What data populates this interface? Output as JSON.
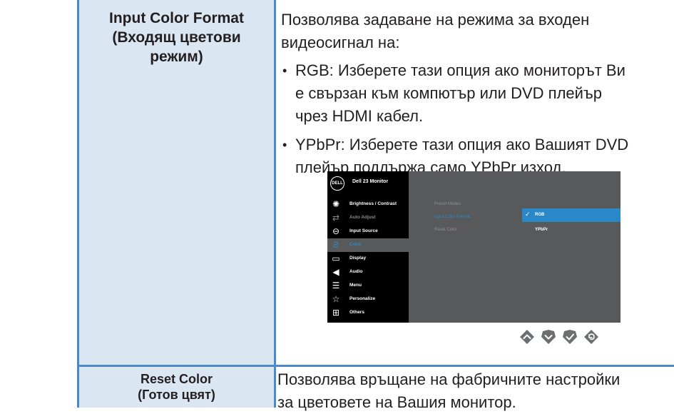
{
  "rows": [
    {
      "label_line1": "Input Color Format",
      "label_line2": "(Входящ цветови",
      "label_line3": "режим)",
      "desc_line1": "Позволява задаване на режима за входен",
      "desc_line2": "видеосигнал на:",
      "bullets": [
        {
          "line1": "RGB: Изберете тази опция ако мониторът Ви",
          "line2": "е свързан към компютър или DVD плейър",
          "line3": "чрез HDMI кабел."
        },
        {
          "line1": "YPbPr: Изберете тази опция ако Вашият DVD",
          "line2": "плейър поддържа само YPbPr изход."
        }
      ]
    },
    {
      "label_line1": "Reset Color",
      "label_line2": "(Готов цвят)",
      "desc_line1": "Позволява връщане на фабричните настройки",
      "desc_line2": "за цветовете на Вашия монитор."
    }
  ],
  "osd": {
    "logo": "DELL",
    "title": "Dell 23 Monitor",
    "menu": [
      {
        "label": "Brightness / Contrast",
        "icon": "brightness-icon",
        "state": "normal"
      },
      {
        "label": "Auto Adjust",
        "icon": "auto-adjust-icon",
        "state": "dim"
      },
      {
        "label": "Input Source",
        "icon": "input-source-icon",
        "state": "normal"
      },
      {
        "label": "Color",
        "icon": "color-icon",
        "state": "active"
      },
      {
        "label": "Display",
        "icon": "display-icon",
        "state": "normal"
      },
      {
        "label": "Audio",
        "icon": "audio-icon",
        "state": "normal"
      },
      {
        "label": "Menu",
        "icon": "menu-icon",
        "state": "normal"
      },
      {
        "label": "Personalize",
        "icon": "star-icon",
        "state": "normal"
      },
      {
        "label": "Others",
        "icon": "others-icon",
        "state": "normal"
      }
    ],
    "submenu": [
      "Preset Modes",
      "Input Color Format",
      "Reset Color"
    ],
    "options": [
      "RGB",
      "YPbPr"
    ],
    "selected_option": "RGB"
  },
  "nav_buttons": [
    "up-arrow-icon",
    "down-arrow-icon",
    "check-icon",
    "back-icon"
  ],
  "colors": {
    "grid": "#4a8bc7",
    "label_cell_bg": "#dbe6f3",
    "osd_accent": "#2e89c9"
  }
}
